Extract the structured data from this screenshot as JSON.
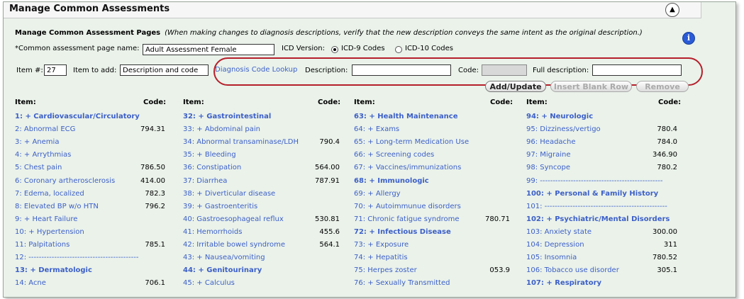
{
  "title": "Manage Common Assessments",
  "collapse_icon": "▲",
  "header": {
    "heading": "Manage Common Assessment Pages",
    "note": "(When making changes to diagnosis descriptions, verify that the new description conveys the same intent as the original description.)"
  },
  "info_icon": "i",
  "form": {
    "page_name_label": "*Common assessment page name:",
    "page_name_value": "Adult Assessment Female",
    "icd_label": "ICD Version:",
    "icd9_label": "ICD-9 Codes",
    "icd10_label": "ICD-10 Codes",
    "item_num_label": "Item #:",
    "item_num_value": "27",
    "item_to_add_label": "Item to add:",
    "item_to_add_value": "Description and code",
    "lookup_link": "Diagnosis Code Lookup",
    "description_label": "Description:",
    "description_value": "",
    "code_label": "Code:",
    "code_value": "",
    "full_desc_label": "Full description:",
    "full_desc_value": ""
  },
  "buttons": {
    "add_update": "Add/Update",
    "insert_blank_row": "Insert Blank Row",
    "remove": "Remove"
  },
  "columns": [
    {
      "item_header": "Item:",
      "code_header": "Code:",
      "rows": [
        {
          "text": "1: + Cardiovascular/Circulatory",
          "code": "",
          "cat": true
        },
        {
          "text": "2: Abnormal ECG",
          "code": "794.31",
          "cat": false
        },
        {
          "text": "3: + Anemia",
          "code": "",
          "cat": false
        },
        {
          "text": "4: + Arrythmias",
          "code": "",
          "cat": false
        },
        {
          "text": "5: Chest pain",
          "code": "786.50",
          "cat": false
        },
        {
          "text": "6: Coronary artherosclerosis",
          "code": "414.00",
          "cat": false
        },
        {
          "text": "7: Edema, localized",
          "code": "782.3",
          "cat": false
        },
        {
          "text": "8: Elevated BP w/o HTN",
          "code": "796.2",
          "cat": false
        },
        {
          "text": "9: + Heart Failure",
          "code": "",
          "cat": false
        },
        {
          "text": "10: + Hypertension",
          "code": "",
          "cat": false
        },
        {
          "text": "11: Palpitations",
          "code": "785.1",
          "cat": false
        },
        {
          "text": "12: -------------------------------------------",
          "code": "",
          "cat": false
        },
        {
          "text": "13: + Dermatologic",
          "code": "",
          "cat": true
        },
        {
          "text": "14: Acne",
          "code": "706.1",
          "cat": false
        }
      ]
    },
    {
      "item_header": "Item:",
      "code_header": "Code:",
      "rows": [
        {
          "text": "32: + Gastrointestinal",
          "code": "",
          "cat": true
        },
        {
          "text": "33: + Abdominal pain",
          "code": "",
          "cat": false
        },
        {
          "text": "34: Abnormal transaminase/LDH",
          "code": "790.4",
          "cat": false
        },
        {
          "text": "35: + Bleeding",
          "code": "",
          "cat": false
        },
        {
          "text": "36: Constipation",
          "code": "564.00",
          "cat": false
        },
        {
          "text": "37: Diarrhea",
          "code": "787.91",
          "cat": false
        },
        {
          "text": "38: + Diverticular disease",
          "code": "",
          "cat": false
        },
        {
          "text": "39: + Gastroenteritis",
          "code": "",
          "cat": false
        },
        {
          "text": "40: Gastroesophageal reflux",
          "code": "530.81",
          "cat": false
        },
        {
          "text": "41: Hemorrhoids",
          "code": "455.6",
          "cat": false
        },
        {
          "text": "42: Irritable bowel syndrome",
          "code": "564.1",
          "cat": false
        },
        {
          "text": "43: + Nausea/vomiting",
          "code": "",
          "cat": false
        },
        {
          "text": "44: + Genitourinary",
          "code": "",
          "cat": true
        },
        {
          "text": "45: + Calculus",
          "code": "",
          "cat": false
        }
      ]
    },
    {
      "item_header": "Item:",
      "code_header": "Code:",
      "rows": [
        {
          "text": "63: + Health Maintenance",
          "code": "",
          "cat": true
        },
        {
          "text": "64: + Exams",
          "code": "",
          "cat": false
        },
        {
          "text": "65: + Long-term Medication Use",
          "code": "",
          "cat": false
        },
        {
          "text": "66: + Screening codes",
          "code": "",
          "cat": false
        },
        {
          "text": "67: + Vaccines/immunizations",
          "code": "",
          "cat": false
        },
        {
          "text": "68: + Immunologic",
          "code": "",
          "cat": true
        },
        {
          "text": "69: + Allergy",
          "code": "",
          "cat": false
        },
        {
          "text": "70: + Autoimmunue disorders",
          "code": "",
          "cat": false
        },
        {
          "text": "71: Chronic fatigue syndrome",
          "code": "780.71",
          "cat": false
        },
        {
          "text": "72: + Infectious Disease",
          "code": "",
          "cat": true
        },
        {
          "text": "73: + Exposure",
          "code": "",
          "cat": false
        },
        {
          "text": "74: + Hepatitis",
          "code": "",
          "cat": false
        },
        {
          "text": "75: Herpes zoster",
          "code": "053.9",
          "cat": false
        },
        {
          "text": "76: + Sexually Transmitted",
          "code": "",
          "cat": false
        }
      ]
    },
    {
      "item_header": "Item:",
      "code_header": "Code:",
      "rows": [
        {
          "text": "94: + Neurologic",
          "code": "",
          "cat": true
        },
        {
          "text": "95: Dizziness/vertigo",
          "code": "780.4",
          "cat": false
        },
        {
          "text": "96: Headache",
          "code": "784.0",
          "cat": false
        },
        {
          "text": "97: Migraine",
          "code": "346.90",
          "cat": false
        },
        {
          "text": "98: Syncope",
          "code": "780.2",
          "cat": false
        },
        {
          "text": "99: ------------------------------------------------",
          "code": "",
          "cat": false
        },
        {
          "text": "100: + Personal & Family History",
          "code": "",
          "cat": true
        },
        {
          "text": "101: ------------------------------------------------",
          "code": "",
          "cat": false
        },
        {
          "text": "102: + Psychiatric/Mental Disorders",
          "code": "",
          "cat": true
        },
        {
          "text": "103: Anxiety state",
          "code": "300.00",
          "cat": false
        },
        {
          "text": "104: Depression",
          "code": "311",
          "cat": false
        },
        {
          "text": "105: Insomnia",
          "code": "780.52",
          "cat": false
        },
        {
          "text": "106: Tobacco use disorder",
          "code": "305.1",
          "cat": false
        },
        {
          "text": "107: + Respiratory",
          "code": "",
          "cat": true
        }
      ]
    }
  ]
}
